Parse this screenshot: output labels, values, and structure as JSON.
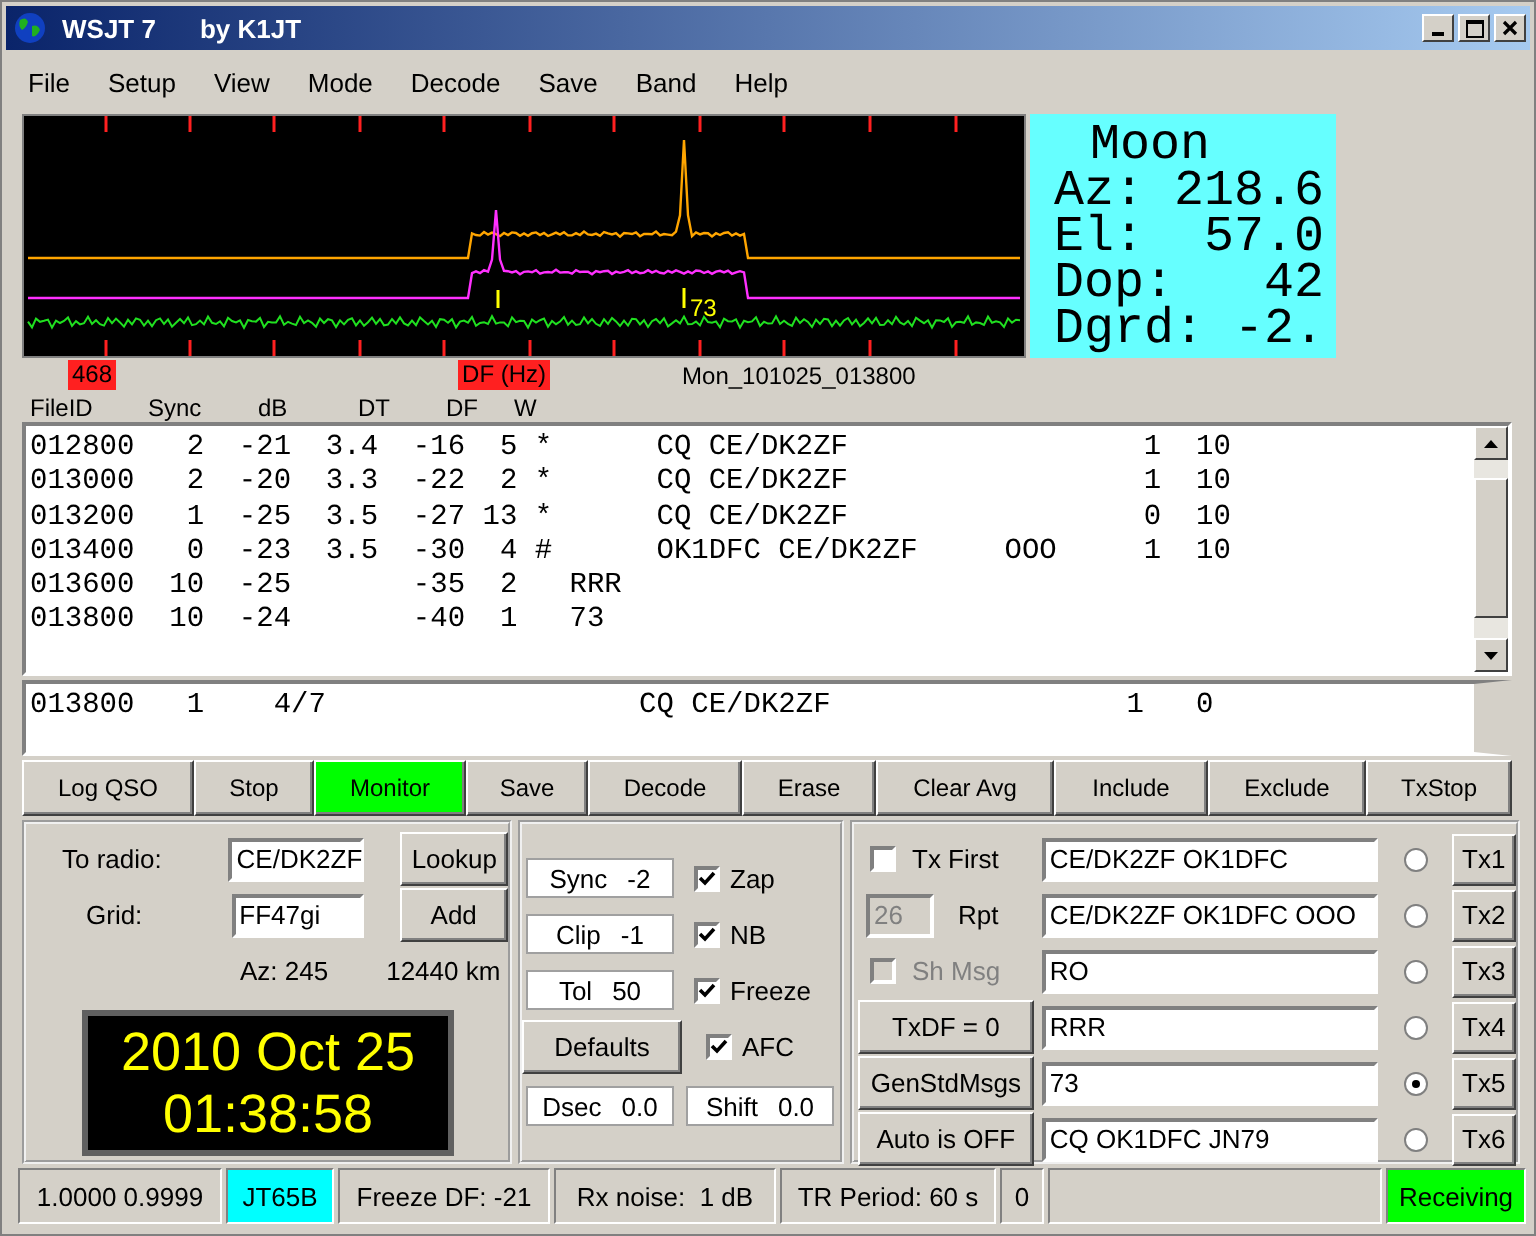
{
  "window": {
    "title": "WSJT 7",
    "subtitle": "by K1JT"
  },
  "menu": [
    "File",
    "Setup",
    "View",
    "Mode",
    "Decode",
    "Save",
    "Band",
    "Help"
  ],
  "spectrum": {
    "marker_label": "73"
  },
  "moon": {
    "title": "Moon",
    "lines": [
      "Az: 218.6",
      "El:  57.0",
      "Dop:   42",
      "Dgrd: -2."
    ]
  },
  "scale": {
    "file_count": "468",
    "df_label": "DF (Hz)",
    "file_name": "Mon_101025_013800"
  },
  "columns": [
    "FileID",
    "Sync",
    "dB",
    "DT",
    "DF",
    "W"
  ],
  "decoded_lines": [
    "012800   2  -21  3.4  -16  5 *      CQ CE/DK2ZF                 1  10",
    "013000   2  -20  3.3  -22  2 *      CQ CE/DK2ZF                 1  10",
    "013200   1  -25  3.5  -27 13 *      CQ CE/DK2ZF                 0  10",
    "013400   0  -23  3.5  -30  4 #      OK1DFC CE/DK2ZF     OOO     1  10",
    "013600  10  -25       -35  2   RRR",
    "013800  10  -24       -40  1   73"
  ],
  "average_lines": [
    "013800   1    4/7                  CQ CE/DK2ZF                 1   0"
  ],
  "buttons": [
    {
      "label": "Log QSO",
      "active": false
    },
    {
      "label": "Stop",
      "active": false
    },
    {
      "label": "Monitor",
      "active": true
    },
    {
      "label": "Save",
      "active": false
    },
    {
      "label": "Decode",
      "active": false
    },
    {
      "label": "Erase",
      "active": false
    },
    {
      "label": "Clear Avg",
      "active": false
    },
    {
      "label": "Include",
      "active": false
    },
    {
      "label": "Exclude",
      "active": false
    },
    {
      "label": "TxStop",
      "active": false
    }
  ],
  "station": {
    "to_radio_label": "To radio:",
    "to_radio": "CE/DK2ZF",
    "lookup": "Lookup",
    "grid_label": "Grid:",
    "grid": "FF47gi",
    "add": "Add",
    "azimuth": "Az: 245",
    "distance": "12440 km",
    "date": "2010 Oct 25",
    "time": "01:38:58"
  },
  "decoder": {
    "spinners": [
      {
        "label": "Sync",
        "value": "-2"
      },
      {
        "label": "Clip",
        "value": "-1"
      },
      {
        "label": "Tol",
        "value": "50"
      }
    ],
    "defaults": "Defaults",
    "options": [
      {
        "label": "Zap",
        "checked": true
      },
      {
        "label": "NB",
        "checked": true
      },
      {
        "label": "Freeze",
        "checked": true
      },
      {
        "label": "AFC",
        "checked": true
      }
    ],
    "dsec": {
      "label": "Dsec",
      "value": "0.0"
    },
    "shift": {
      "label": "Shift",
      "value": "0.0"
    }
  },
  "tx": {
    "controls": [
      {
        "kind": "checkbox",
        "label": "Tx First",
        "checked": false,
        "disabled": false
      },
      {
        "kind": "report",
        "value": "26",
        "label": "Rpt",
        "disabled": true
      },
      {
        "kind": "checkbox",
        "label": "Sh Msg",
        "checked": false,
        "disabled": true
      },
      {
        "kind": "button",
        "label": "TxDF = 0"
      },
      {
        "kind": "button",
        "label": "GenStdMsgs"
      },
      {
        "kind": "button",
        "label": "Auto is OFF"
      }
    ],
    "messages": [
      {
        "text": "CE/DK2ZF OK1DFC",
        "selected": false,
        "button": "Tx1"
      },
      {
        "text": "CE/DK2ZF OK1DFC OOO",
        "selected": false,
        "button": "Tx2"
      },
      {
        "text": "RO",
        "selected": false,
        "button": "Tx3"
      },
      {
        "text": "RRR",
        "selected": false,
        "button": "Tx4"
      },
      {
        "text": "73",
        "selected": true,
        "button": "Tx5"
      },
      {
        "text": "CQ OK1DFC JN79",
        "selected": false,
        "button": "Tx6"
      }
    ]
  },
  "status_bar": [
    {
      "text": "1.0000 0.9999"
    },
    {
      "text": "JT65B",
      "color": "#00ffff"
    },
    {
      "text": "Freeze DF: -21"
    },
    {
      "text": "Rx noise:  1 dB"
    },
    {
      "text": "TR Period: 60 s"
    },
    {
      "text": "0"
    },
    {
      "text": "Receiving",
      "color": "#00ff00"
    }
  ]
}
